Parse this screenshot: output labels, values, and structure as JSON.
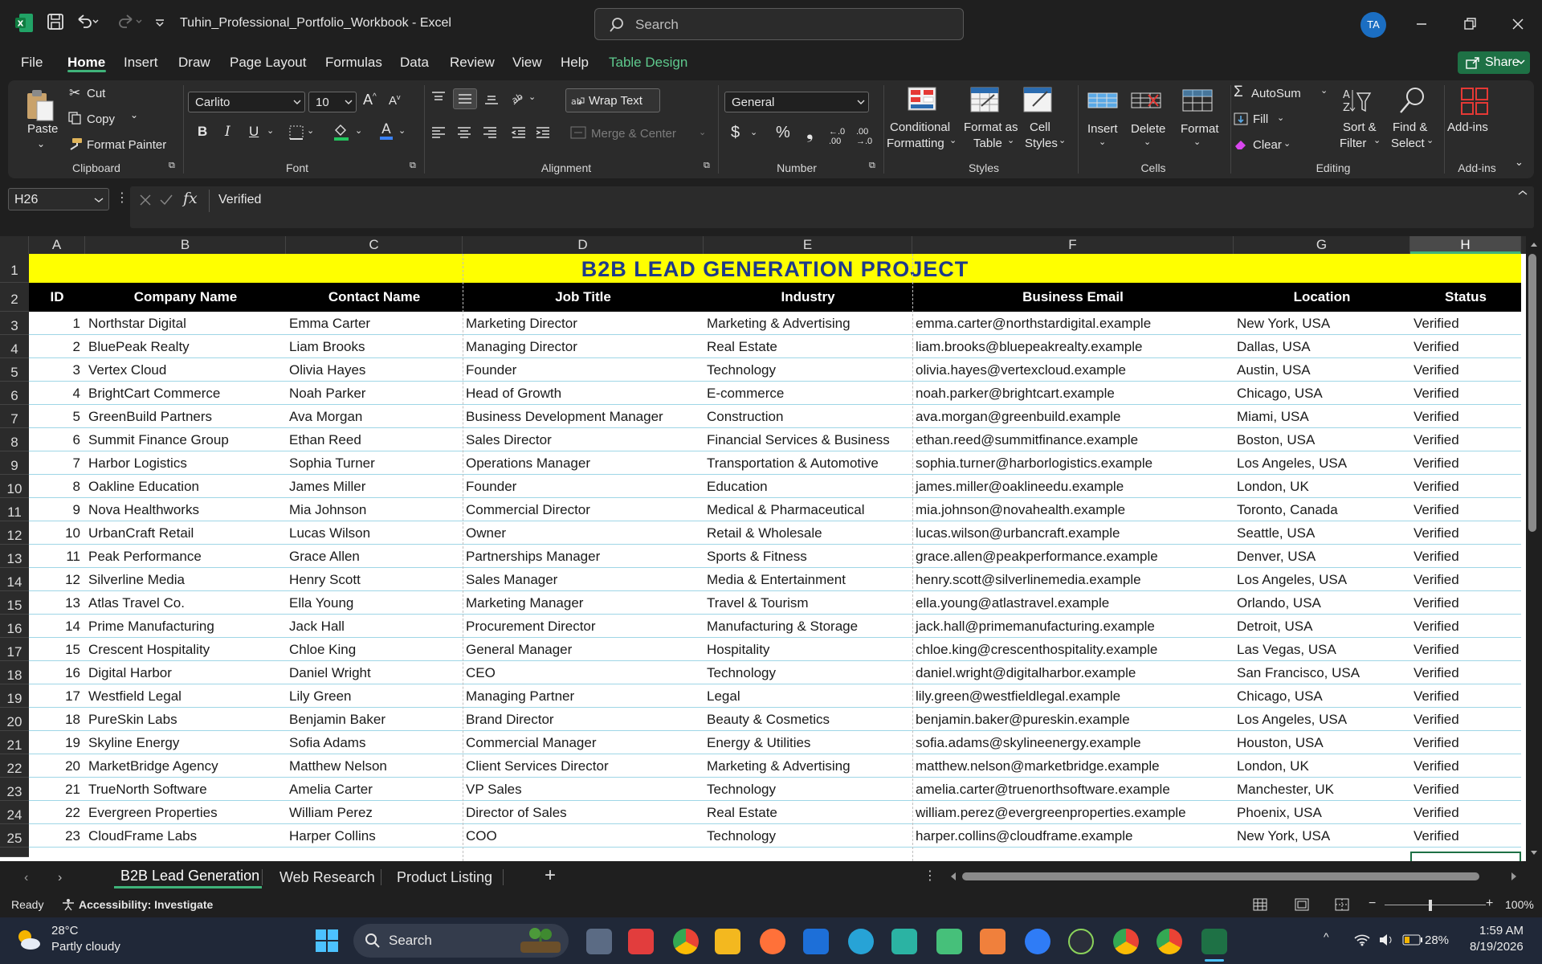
{
  "titlebar": {
    "doc_title": "Tuhin_Professional_Portfolio_Workbook  -  Excel",
    "search_placeholder": "Search",
    "avatar_initials": "TA"
  },
  "menu": {
    "items": [
      "File",
      "Home",
      "Insert",
      "Draw",
      "Page Layout",
      "Formulas",
      "Data",
      "Review",
      "View",
      "Help",
      "Table Design"
    ],
    "active": "Home",
    "share_label": "Share"
  },
  "ribbon": {
    "clipboard": {
      "paste": "Paste",
      "cut": "Cut",
      "copy": "Copy",
      "format_painter": "Format Painter",
      "group": "Clipboard"
    },
    "font": {
      "name": "Carlito",
      "size": "10",
      "group": "Font"
    },
    "alignment": {
      "wrap_text": "Wrap Text",
      "merge_center": "Merge & Center",
      "group": "Alignment"
    },
    "number": {
      "format": "General",
      "group": "Number"
    },
    "styles": {
      "conditional": "Conditional",
      "formatting": "Formatting",
      "format_as": "Format as",
      "table": "Table",
      "cell": "Cell",
      "styles_lbl": "Styles",
      "group": "Styles"
    },
    "cells": {
      "insert": "Insert",
      "delete": "Delete",
      "format": "Format",
      "group": "Cells"
    },
    "editing": {
      "autosum": "AutoSum",
      "fill": "Fill",
      "clear": "Clear",
      "sort": "Sort &",
      "filter": "Filter",
      "find": "Find &",
      "select": "Select",
      "group": "Editing"
    },
    "addins": {
      "label": "Add-ins",
      "group": "Add-ins"
    }
  },
  "formula_bar": {
    "name_box": "H26",
    "value": "Verified"
  },
  "sheet": {
    "columns": [
      "A",
      "B",
      "C",
      "D",
      "E",
      "F",
      "G",
      "H"
    ],
    "selected_column": "H",
    "banner": "B2B LEAD GENERATION  PROJECT",
    "headers": [
      "ID",
      "Company Name",
      "Contact Name",
      "Job Title",
      "Industry",
      "Business Email",
      "Location",
      "Status"
    ],
    "row_numbers": [
      "1",
      "2",
      "3",
      "4",
      "5",
      "6",
      "7",
      "8",
      "9",
      "10",
      "11",
      "12",
      "13",
      "14",
      "15",
      "16",
      "17",
      "18",
      "19",
      "20",
      "21",
      "22",
      "23",
      "24",
      "25"
    ],
    "rows": [
      [
        "1",
        "Northstar Digital",
        "Emma Carter",
        "Marketing Director",
        "Marketing & Advertising",
        "emma.carter@northstardigital.example",
        "New York, USA",
        "Verified"
      ],
      [
        "2",
        "BluePeak Realty",
        "Liam Brooks",
        "Managing Director",
        "Real Estate",
        "liam.brooks@bluepeakrealty.example",
        "Dallas, USA",
        "Verified"
      ],
      [
        "3",
        "Vertex Cloud",
        "Olivia Hayes",
        "Founder",
        "Technology",
        "olivia.hayes@vertexcloud.example",
        "Austin, USA",
        "Verified"
      ],
      [
        "4",
        "BrightCart Commerce",
        "Noah Parker",
        "Head of Growth",
        "E-commerce",
        "noah.parker@brightcart.example",
        "Chicago, USA",
        "Verified"
      ],
      [
        "5",
        "GreenBuild Partners",
        "Ava Morgan",
        "Business Development Manager",
        "Construction",
        "ava.morgan@greenbuild.example",
        "Miami, USA",
        "Verified"
      ],
      [
        "6",
        "Summit Finance Group",
        "Ethan Reed",
        "Sales Director",
        "Financial Services & Business",
        "ethan.reed@summitfinance.example",
        "Boston, USA",
        "Verified"
      ],
      [
        "7",
        "Harbor Logistics",
        "Sophia Turner",
        "Operations Manager",
        "Transportation & Automotive",
        "sophia.turner@harborlogistics.example",
        "Los Angeles, USA",
        "Verified"
      ],
      [
        "8",
        "Oakline Education",
        "James Miller",
        "Founder",
        "Education",
        "james.miller@oaklineedu.example",
        "London, UK",
        "Verified"
      ],
      [
        "9",
        "Nova Healthworks",
        "Mia Johnson",
        "Commercial Director",
        "Medical & Pharmaceutical",
        "mia.johnson@novahealth.example",
        "Toronto, Canada",
        "Verified"
      ],
      [
        "10",
        "UrbanCraft Retail",
        "Lucas Wilson",
        "Owner",
        "Retail & Wholesale",
        "lucas.wilson@urbancraft.example",
        "Seattle, USA",
        "Verified"
      ],
      [
        "11",
        "Peak Performance",
        "Grace Allen",
        "Partnerships Manager",
        "Sports & Fitness",
        "grace.allen@peakperformance.example",
        "Denver, USA",
        "Verified"
      ],
      [
        "12",
        "Silverline Media",
        "Henry Scott",
        "Sales Manager",
        "Media & Entertainment",
        "henry.scott@silverlinemedia.example",
        "Los Angeles, USA",
        "Verified"
      ],
      [
        "13",
        "Atlas Travel Co.",
        "Ella Young",
        "Marketing Manager",
        "Travel & Tourism",
        "ella.young@atlastravel.example",
        "Orlando, USA",
        "Verified"
      ],
      [
        "14",
        "Prime Manufacturing",
        "Jack Hall",
        "Procurement Director",
        "Manufacturing & Storage",
        "jack.hall@primemanufacturing.example",
        "Detroit, USA",
        "Verified"
      ],
      [
        "15",
        "Crescent Hospitality",
        "Chloe King",
        "General Manager",
        "Hospitality",
        "chloe.king@crescenthospitality.example",
        "Las Vegas, USA",
        "Verified"
      ],
      [
        "16",
        "Digital Harbor",
        "Daniel Wright",
        "CEO",
        "Technology",
        "daniel.wright@digitalharbor.example",
        "San Francisco, USA",
        "Verified"
      ],
      [
        "17",
        "Westfield Legal",
        "Lily Green",
        "Managing Partner",
        "Legal",
        "lily.green@westfieldlegal.example",
        "Chicago, USA",
        "Verified"
      ],
      [
        "18",
        "PureSkin Labs",
        "Benjamin Baker",
        "Brand Director",
        "Beauty & Cosmetics",
        "benjamin.baker@pureskin.example",
        "Los Angeles, USA",
        "Verified"
      ],
      [
        "19",
        "Skyline Energy",
        "Sofia Adams",
        "Commercial Manager",
        "Energy & Utilities",
        "sofia.adams@skylineenergy.example",
        "Houston, USA",
        "Verified"
      ],
      [
        "20",
        "MarketBridge Agency",
        "Matthew Nelson",
        "Client Services Director",
        "Marketing & Advertising",
        "matthew.nelson@marketbridge.example",
        "London, UK",
        "Verified"
      ],
      [
        "21",
        "TrueNorth Software",
        "Amelia Carter",
        "VP Sales",
        "Technology",
        "amelia.carter@truenorthsoftware.example",
        "Manchester, UK",
        "Verified"
      ],
      [
        "22",
        "Evergreen Properties",
        "William Perez",
        "Director of Sales",
        "Real Estate",
        "william.perez@evergreenproperties.example",
        "Phoenix, USA",
        "Verified"
      ],
      [
        "23",
        "CloudFrame Labs",
        "Harper Collins",
        "COO",
        "Technology",
        "harper.collins@cloudframe.example",
        "New York, USA",
        "Verified"
      ]
    ]
  },
  "tabs": {
    "items": [
      "B2B Lead Generation",
      "Web Research",
      "Product Listing"
    ],
    "active": "B2B Lead Generation"
  },
  "status": {
    "ready": "Ready",
    "accessibility": "Accessibility: Investigate",
    "zoom": "100%"
  },
  "taskbar": {
    "weather_temp": "28°C",
    "weather_desc": "Partly cloudy",
    "search": "Search",
    "battery": "28%",
    "time": "1:59 AM",
    "date": "8/19/2026"
  },
  "colors": {
    "accent_green": "#3fb37a",
    "banner_yellow": "#ffff00",
    "banner_text": "#1e3a8a",
    "excel_green": "#1e7145"
  }
}
